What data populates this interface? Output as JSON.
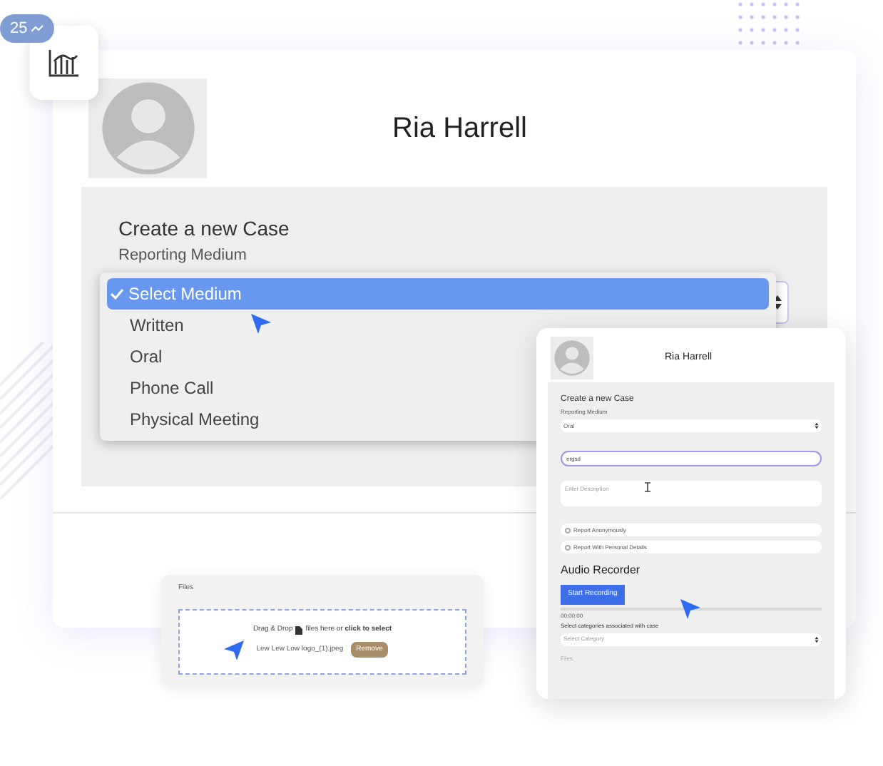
{
  "badge": {
    "value": "25"
  },
  "main_card": {
    "user_name": "Ria Harrell",
    "form_title": "Create a new Case",
    "medium_label": "Reporting Medium",
    "medium_options": [
      {
        "label": "Select Medium",
        "selected": true
      },
      {
        "label": "Written",
        "selected": false
      },
      {
        "label": "Oral",
        "selected": false
      },
      {
        "label": "Phone Call",
        "selected": false
      },
      {
        "label": "Physical Meeting",
        "selected": false
      }
    ]
  },
  "files_card": {
    "label": "Files",
    "drop_prefix": "Drag & Drop",
    "drop_suffix": "files here or **click to select**",
    "file_name": "Lew Lew Low logo_(1).jpeg",
    "remove_button": "Remove"
  },
  "phone_card": {
    "user_name": "Ria Harrell",
    "form_title": "Create a new Case",
    "medium_label": "Reporting Medium",
    "medium_value": "Oral",
    "name_value": "ergsd",
    "description_placeholder": "Enter Description",
    "options": [
      {
        "label": "Report Anonymously",
        "checked": false
      },
      {
        "label": "Report With Personal Details",
        "checked": false
      }
    ],
    "recorder_title": "Audio Recorder",
    "record_button": "Start Recording",
    "progress": {
      "level": 0
    },
    "time": "00:00:00",
    "category_label": "Select categories associated with case",
    "category_placeholder": "Select Category",
    "files_label": "Files"
  }
}
